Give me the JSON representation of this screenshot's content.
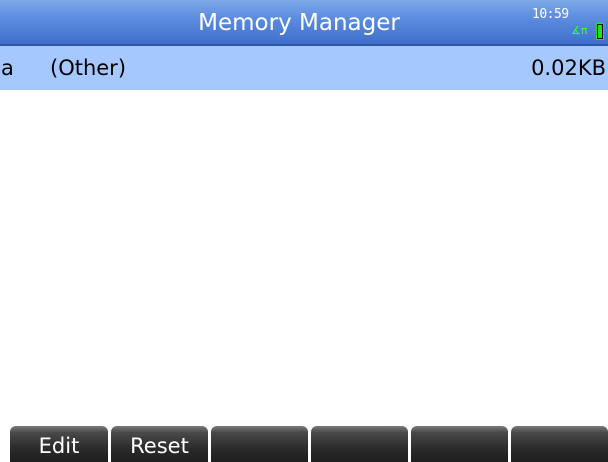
{
  "title_bar": {
    "title": "Memory Manager",
    "clock": "10:59",
    "angle_mode_indicator": "∡π",
    "battery_color": "#22dd22"
  },
  "rows": [
    {
      "letter": "a",
      "name": "(Other)",
      "size": "0.02KB",
      "selected": true
    }
  ],
  "softkeys": [
    {
      "label": "Edit"
    },
    {
      "label": "Reset"
    },
    {
      "label": ""
    },
    {
      "label": ""
    },
    {
      "label": ""
    },
    {
      "label": ""
    }
  ],
  "colors": {
    "title_bar": "#5d8ddf",
    "selected_row": "#a5c9ff",
    "softkey": "#2c2c2c"
  }
}
